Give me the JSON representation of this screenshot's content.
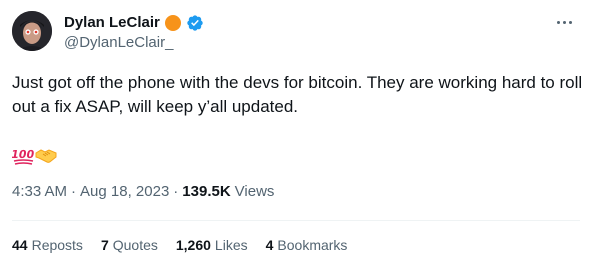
{
  "author": {
    "display_name": "Dylan LeClair",
    "handle": "@DylanLeClair_",
    "badge_orange_icon": "bitcoin-circle-icon",
    "badge_verified_icon": "verified-badge-icon",
    "colors": {
      "orange_badge": "#f7931a",
      "verified_badge": "#1d9bf0"
    }
  },
  "tweet": {
    "text": "Just got off the phone with the devs for bitcoin. They are working hard to roll out a fix ASAP, will keep y’all updated.",
    "emojis": [
      "💯",
      "🤝"
    ]
  },
  "meta": {
    "time": "4:33 AM",
    "separator": "·",
    "date": "Aug 18, 2023",
    "views_count": "139.5K",
    "views_label": "Views"
  },
  "stats": [
    {
      "count": "44",
      "label": "Reposts"
    },
    {
      "count": "7",
      "label": "Quotes"
    },
    {
      "count": "1,260",
      "label": "Likes"
    },
    {
      "count": "4",
      "label": "Bookmarks"
    }
  ],
  "more_menu_icon": "more-horizontal-icon"
}
